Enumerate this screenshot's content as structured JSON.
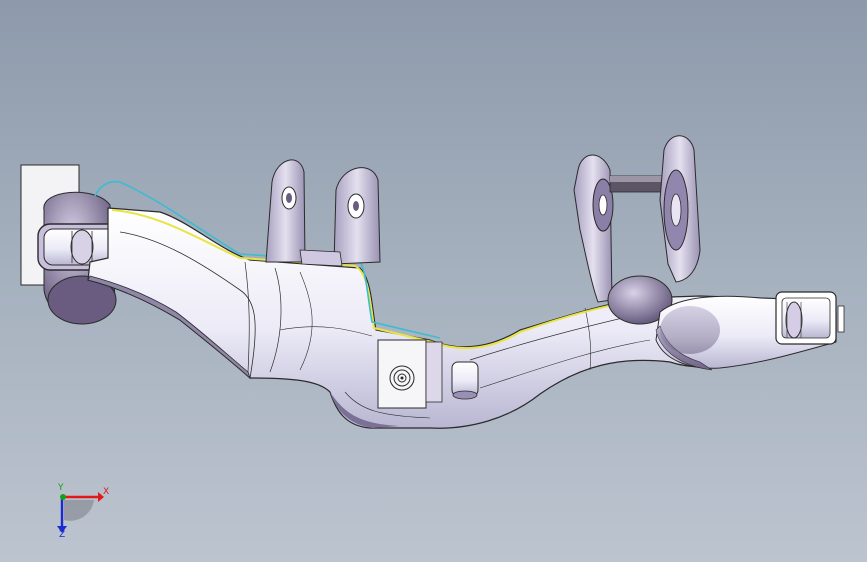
{
  "viewport": {
    "background_top": "#8d9aab",
    "background_bottom": "#bcc4cf",
    "model": "subframe-crossmember-part",
    "edge_color": "#2b2b2b",
    "highlight_yellow": "#e9e445",
    "highlight_cyan": "#3bbcd0"
  },
  "triad": {
    "x_label": "X",
    "y_label": "Y",
    "z_label": "Z",
    "x_color": "#e11919",
    "y_color": "#16a016",
    "z_color": "#1a2bd0"
  }
}
